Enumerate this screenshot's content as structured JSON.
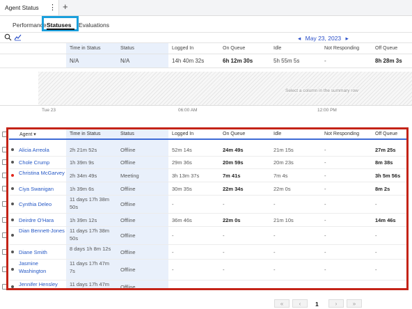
{
  "window": {
    "title": "Agent Status",
    "more_label": "⋮",
    "add_label": "+"
  },
  "tabs": [
    {
      "label": "Performance"
    },
    {
      "label": "Statuses"
    },
    {
      "label": "Evaluations"
    }
  ],
  "toolbar": {
    "prev": "◂",
    "date": "May 23, 2023",
    "next": "▸"
  },
  "summary": {
    "columns": [
      "Time in Status",
      "Status",
      "Logged In",
      "On Queue",
      "Idle",
      "Not Responding",
      "Off Queue"
    ],
    "values": [
      "N/A",
      "N/A",
      "14h 40m 32s",
      "6h 12m 30s",
      "5h 55m 5s",
      "-",
      "8h 28m 3s"
    ],
    "chart_hint": "Select a column in the summary row",
    "axis": [
      "Tue 23",
      "06:00 AM",
      "12:00 PM"
    ]
  },
  "table": {
    "headers": {
      "agent": "Agent",
      "time": "Time in Status",
      "status": "Status",
      "logged": "Logged In",
      "onqueue": "On Queue",
      "idle": "Idle",
      "notresp": "Not Responding",
      "offqueue": "Off Queue"
    },
    "rows": [
      {
        "agent": "Alicia Arreola",
        "time": "2h 21m 52s",
        "status": "Offline",
        "logged": "52m 14s",
        "onqueue": "24m 49s",
        "idle": "21m 15s",
        "notresp": "-",
        "offqueue": "27m 25s"
      },
      {
        "agent": "Chole Crump",
        "time": "1h 39m 9s",
        "status": "Offline",
        "logged": "29m 36s",
        "onqueue": "20m 59s",
        "idle": "20m 23s",
        "notresp": "-",
        "offqueue": "8m 38s"
      },
      {
        "agent": "Christina McGarvey",
        "time": "2h 34m 49s",
        "status": "Meeting",
        "logged": "3h 13m 37s",
        "onqueue": "7m 41s",
        "idle": "7m 4s",
        "notresp": "-",
        "offqueue": "3h 5m 56s"
      },
      {
        "agent": "Ciya Swanigan",
        "time": "1h 39m 6s",
        "status": "Offline",
        "logged": "30m 35s",
        "onqueue": "22m 34s",
        "idle": "22m 0s",
        "notresp": "-",
        "offqueue": "8m 2s"
      },
      {
        "agent": "Cynthia Deleo",
        "time": "11 days 17h 38m 50s",
        "status": "Offline",
        "logged": "-",
        "onqueue": "-",
        "idle": "-",
        "notresp": "-",
        "offqueue": "-"
      },
      {
        "agent": "Deirdre O'Hara",
        "time": "1h 39m 12s",
        "status": "Offline",
        "logged": "36m 46s",
        "onqueue": "22m 0s",
        "idle": "21m 10s",
        "notresp": "-",
        "offqueue": "14m 46s"
      },
      {
        "agent": "Dian Bennett-Jones",
        "time": "11 days 17h 38m 50s",
        "status": "Offline",
        "logged": "-",
        "onqueue": "-",
        "idle": "-",
        "notresp": "-",
        "offqueue": "-"
      },
      {
        "agent": "Diane Smith",
        "time": "8 days 1h 8m 12s",
        "status": "Offline",
        "logged": "-",
        "onqueue": "-",
        "idle": "-",
        "notresp": "-",
        "offqueue": "-"
      },
      {
        "agent": "Jasmine Washington",
        "time": "11 days 17h 47m 7s",
        "status": "Offline",
        "logged": "-",
        "onqueue": "-",
        "idle": "-",
        "notresp": "-",
        "offqueue": "-"
      },
      {
        "agent": "Jennifer Hensley",
        "time": "11 days 17h 47m",
        "status": "Offline",
        "logged": "",
        "onqueue": "",
        "idle": "",
        "notresp": "",
        "offqueue": ""
      }
    ]
  },
  "pager": {
    "first": "«",
    "prev": "‹",
    "page": "1",
    "next": "›",
    "last": "»"
  }
}
